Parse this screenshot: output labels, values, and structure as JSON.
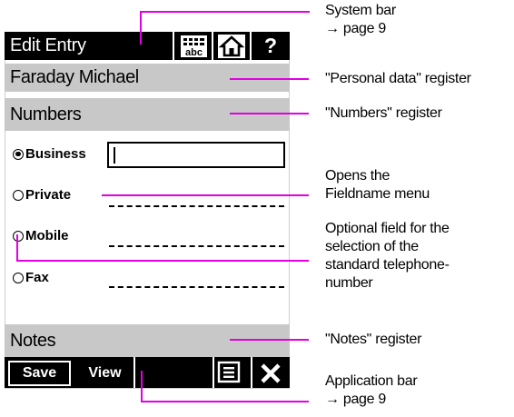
{
  "system_bar": {
    "title": "Edit Entry",
    "icons": [
      "keyboard-abc-icon",
      "home-icon",
      "help-icon"
    ],
    "abc_text": "abc",
    "help_glyph": "?"
  },
  "registers": {
    "personal": "Faraday Michael",
    "numbers": "Numbers",
    "notes": "Notes"
  },
  "fields": {
    "business": {
      "label": "Business",
      "selected": true,
      "value": ""
    },
    "private": {
      "label": "Private",
      "selected": false
    },
    "mobile": {
      "label": "Mobile",
      "selected": false
    },
    "fax": {
      "label": "Fax",
      "selected": false
    }
  },
  "app_bar": {
    "save_label": "Save",
    "view_label": "View",
    "icons": [
      "menu-list-icon",
      "close-icon"
    ]
  },
  "annotations": {
    "system_bar": [
      "System bar",
      "→ page 9"
    ],
    "personal_register": "\"Personal data\" register",
    "numbers_register": "\"Numbers\" register",
    "fieldname_menu": [
      "Opens the",
      "Fieldname menu"
    ],
    "optional_field": [
      "Optional field for the",
      "selection of the",
      "standard telephone-",
      "number"
    ],
    "notes_register": "\"Notes\" register",
    "application_bar": [
      "Application bar",
      "→ page 9"
    ]
  },
  "colors": {
    "callout": "#e400e4",
    "register_bg": "#c8c8c8",
    "bar_bg": "#000000"
  }
}
